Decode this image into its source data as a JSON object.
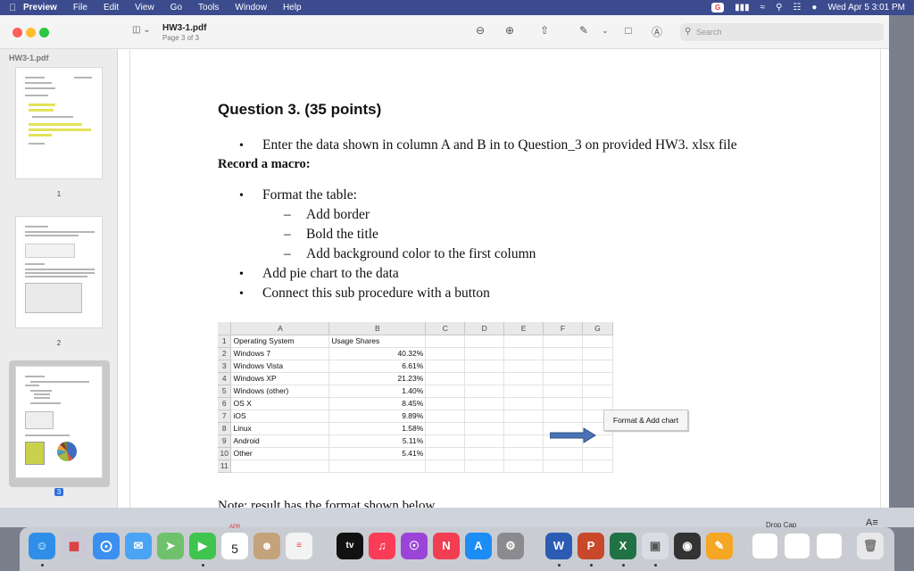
{
  "menubar": {
    "app": "Preview",
    "menus": [
      "File",
      "Edit",
      "View",
      "Go",
      "Tools",
      "Window",
      "Help"
    ],
    "clock": "Wed Apr 5  3:01 PM"
  },
  "window": {
    "title": "HW3-1.pdf",
    "subtitle": "Page 3 of 3",
    "search_placeholder": "Search",
    "sidebar_title": "HW3-1.pdf",
    "pages": [
      "1",
      "2",
      "3"
    ]
  },
  "doc": {
    "question_title": "Question 3.  (35 points)",
    "line1": "Enter the data shown in column A and B in to Question_3 on provided HW3. xlsx file",
    "record": "Record a macro:",
    "items": [
      "Format the table:",
      "Add pie chart to the data",
      "Connect this sub procedure with a button"
    ],
    "subitems": [
      "Add border",
      "Bold the title",
      "Add background color to the first column"
    ],
    "note": "Note: result has the format shown below"
  },
  "sheet": {
    "columns": [
      "",
      "A",
      "B",
      "C",
      "D",
      "E",
      "F",
      "G"
    ],
    "rows": [
      [
        "1",
        "Operating System",
        "Usage Shares"
      ],
      [
        "2",
        "Windows 7",
        "40.32%"
      ],
      [
        "3",
        "Windows Vista",
        "6.61%"
      ],
      [
        "4",
        "Windows XP",
        "21.23%"
      ],
      [
        "5",
        "Windows (other)",
        "1.40%"
      ],
      [
        "6",
        "OS X",
        "8.45%"
      ],
      [
        "7",
        "iOS",
        "9.89%"
      ],
      [
        "8",
        "Linux",
        "1.58%"
      ],
      [
        "9",
        "Android",
        "5.11%"
      ],
      [
        "10",
        "Other",
        "5.41%"
      ],
      [
        "11",
        "",
        ""
      ]
    ],
    "button_label": "Format & Add chart"
  },
  "desktop": {
    "drop_cap": "Drop Cap",
    "calendar_month": "APR",
    "calendar_day": "5"
  },
  "dock_icons": [
    "finder-icon",
    "launchpad-icon",
    "safari-icon",
    "mail-icon",
    "maps-icon",
    "facetime-icon",
    "calendar-icon",
    "contacts-icon",
    "reminders-icon",
    "appletv-icon",
    "music-icon",
    "podcasts-icon",
    "news-icon",
    "appstore-icon",
    "settings-icon",
    "word-icon",
    "powerpoint-icon",
    "excel-icon",
    "preview-icon",
    "photobooth-icon",
    "pages-icon",
    "trash-icon"
  ],
  "colors": {
    "menubar": "#3b4b8e",
    "selection": "#2f6fe0",
    "arrow": "#4a73b5"
  }
}
